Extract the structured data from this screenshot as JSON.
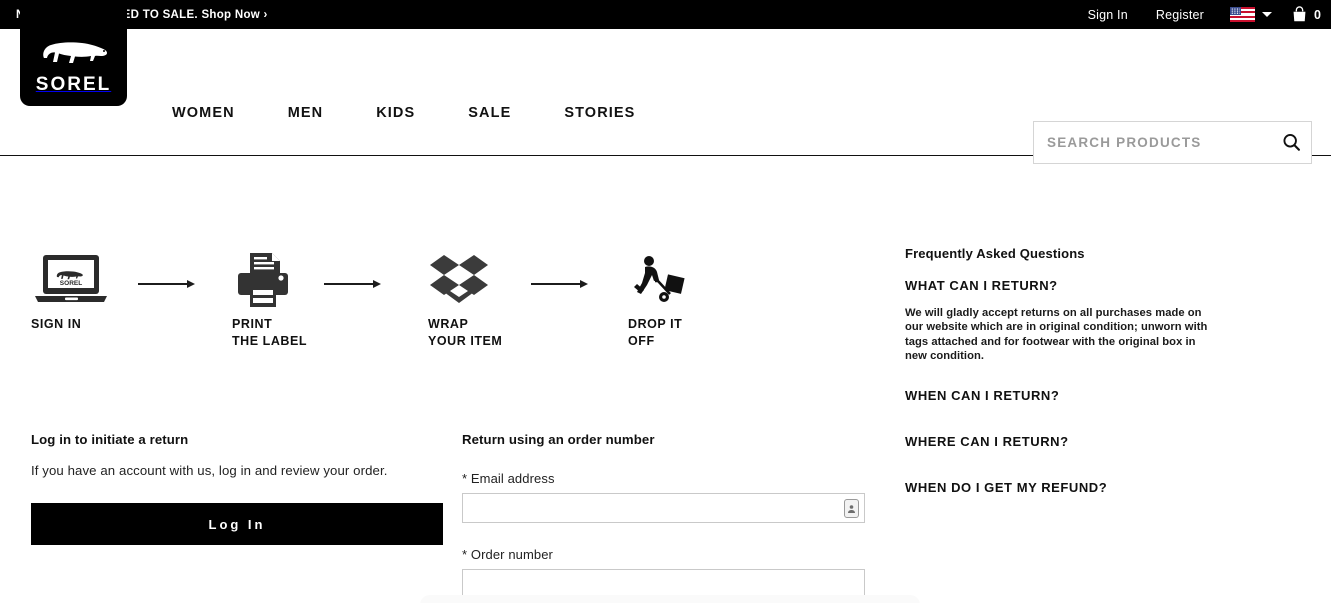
{
  "promo": {
    "message": "NEW STYLES ADDED TO SALE.",
    "cta": "Shop Now ›",
    "sign_in": "Sign In",
    "register": "Register",
    "locale_icon": "us-flag-icon",
    "locale_caret_icon": "chevron-down-icon",
    "bag_icon": "shopping-bag-icon",
    "bag_count": "0"
  },
  "header": {
    "logo_word": "SOREL",
    "logo_icon": "polar-bear-icon",
    "nav": [
      {
        "label": "WOMEN"
      },
      {
        "label": "MEN"
      },
      {
        "label": "KIDS"
      },
      {
        "label": "SALE"
      },
      {
        "label": "STORIES"
      }
    ],
    "search": {
      "placeholder": "SEARCH PRODUCTS",
      "value": "",
      "icon": "search-icon"
    }
  },
  "steps": [
    {
      "icon": "laptop-sign-in-icon",
      "line1": "SIGN IN",
      "line2": ""
    },
    {
      "icon": "printer-icon",
      "line1": "PRINT",
      "line2": "THE LABEL"
    },
    {
      "icon": "wrap-box-icon",
      "line1": "WRAP",
      "line2": "YOUR ITEM"
    },
    {
      "icon": "hand-truck-delivery-icon",
      "line1": "DROP IT",
      "line2": "OFF"
    }
  ],
  "faq": {
    "title": "Frequently Asked Questions",
    "items": [
      {
        "question": "WHAT CAN I RETURN?",
        "answer": "We will gladly accept returns on all purchases made on our website which are in original condition; unworn with tags attached and for footwear with the original box in new condition."
      },
      {
        "question": "WHEN CAN I RETURN?",
        "answer": ""
      },
      {
        "question": "WHERE CAN I RETURN?",
        "answer": ""
      },
      {
        "question": "WHEN DO I GET MY REFUND?",
        "answer": ""
      }
    ]
  },
  "login": {
    "heading": "Log in to initiate a return",
    "subtext": "If you have an account with us, log in and review your order.",
    "button_label": "Log In"
  },
  "order_form": {
    "heading": "Return using an order number",
    "email_label": "* Email address",
    "email_value": "",
    "email_placeholder": "",
    "autofill_icon": "contact-card-icon",
    "order_label": "* Order number",
    "order_value": "",
    "order_placeholder": ""
  },
  "colors": {
    "black": "#000000",
    "text": "#111111",
    "border": "#c9c9c9",
    "placeholder": "#9a9a9a"
  }
}
